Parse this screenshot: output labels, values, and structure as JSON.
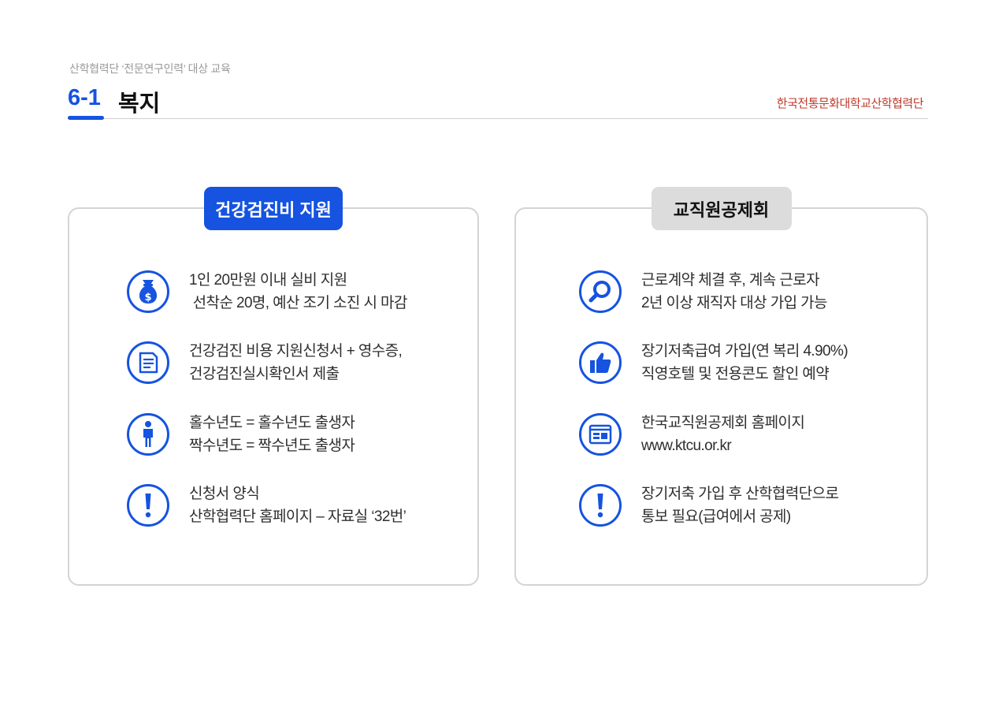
{
  "header": {
    "subtitle": "산학협력단 ‘전문연구인력’ 대상 교육",
    "section_number": "6-1",
    "section_title": "복지",
    "logo_text": "한국전통문화대학교산학협력단"
  },
  "cards": [
    {
      "tag": "건강검진비 지원",
      "items": [
        {
          "icon": "money-bag-icon",
          "line1": "1인 20만원 이내 실비 지원",
          "line2": " 선착순 20명, 예산 조기 소진 시 마감"
        },
        {
          "icon": "document-icon",
          "line1": "건강검진 비용 지원신청서 + 영수증,",
          "line2": "건강검진실시확인서 제출"
        },
        {
          "icon": "person-icon",
          "line1": "홀수년도 = 홀수년도 출생자",
          "line2": "짝수년도 = 짝수년도 출생자"
        },
        {
          "icon": "exclamation-icon",
          "line1": "신청서 양식",
          "line2": "산학협력단 홈페이지 – 자료실 ‘32번’"
        }
      ]
    },
    {
      "tag": "교직원공제회",
      "items": [
        {
          "icon": "search-icon",
          "line1": "근로계약 체결 후, 계속 근로자",
          "line2": "2년 이상 재직자 대상 가입 가능"
        },
        {
          "icon": "thumbs-up-icon",
          "line1": "장기저축급여 가입(연 복리 4.90%)",
          "line2": "직영호텔 및 전용콘도 할인 예약"
        },
        {
          "icon": "webpage-icon",
          "line1": "한국교직원공제회 홈페이지",
          "line2": "www.ktcu.or.kr"
        },
        {
          "icon": "exclamation-icon",
          "line1": "장기저축 가입 후 산학협력단으로",
          "line2": "통보 필요(급여에서 공제)"
        }
      ]
    }
  ],
  "colors": {
    "accent": "#1553e0",
    "tag_gray": "#dcdcdc",
    "border": "#d4d4d4"
  }
}
